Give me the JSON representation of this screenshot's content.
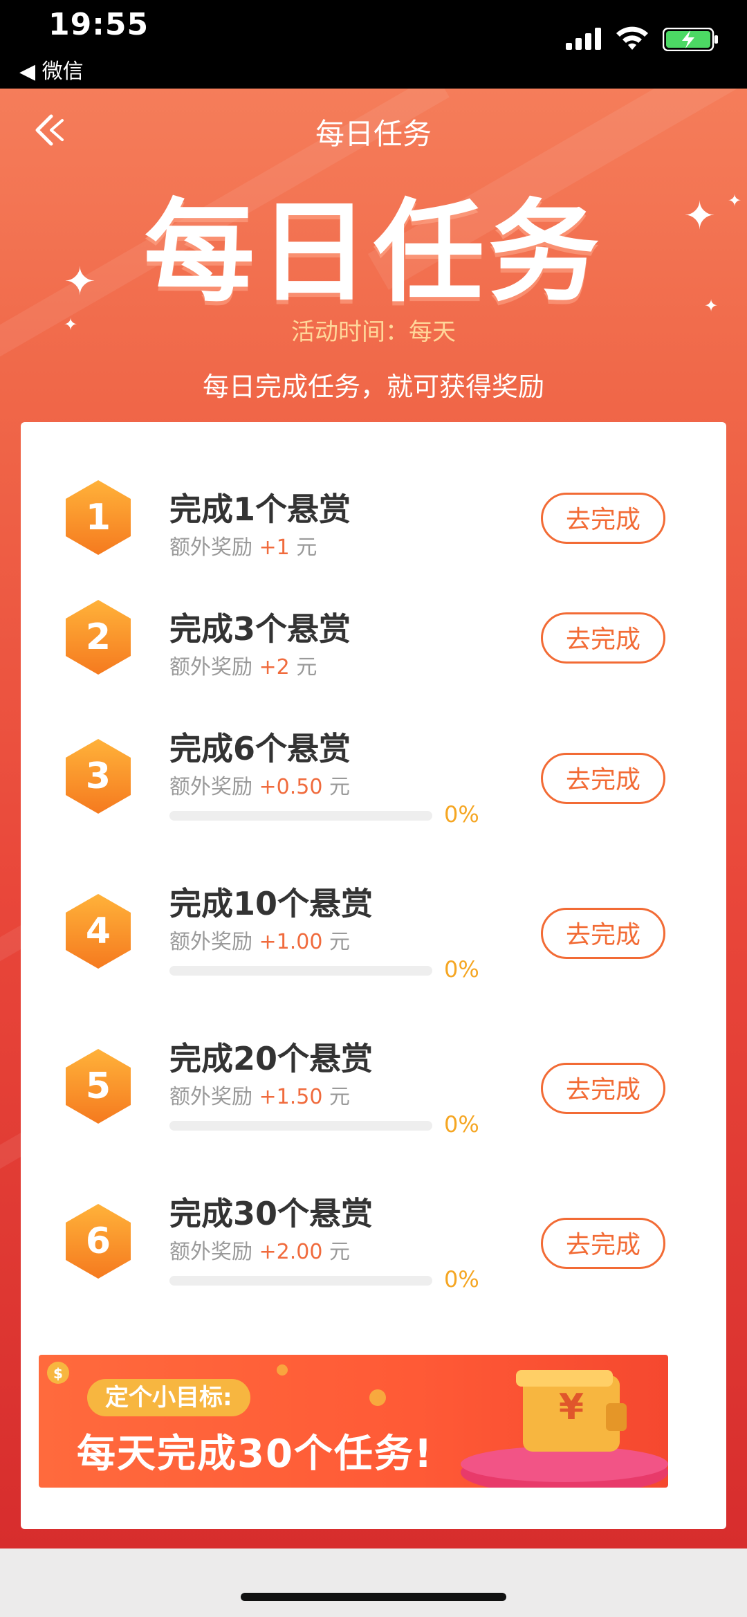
{
  "status_bar": {
    "time": "19:55",
    "back_app": "微信"
  },
  "header": {
    "nav_title": "每日任务",
    "hero_title": "每日任务",
    "activity_time": "活动时间：每天",
    "subtitle": "每日完成任务，就可获得奖励"
  },
  "tasks": [
    {
      "num": "1",
      "title": "完成1个悬赏",
      "reward_prefix": "额外奖励",
      "reward_amount": "+1",
      "reward_unit": "元",
      "button": "去完成"
    },
    {
      "num": "2",
      "title": "完成3个悬赏",
      "reward_prefix": "额外奖励",
      "reward_amount": "+2",
      "reward_unit": "元",
      "button": "去完成"
    },
    {
      "num": "3",
      "title": "完成6个悬赏",
      "reward_prefix": "额外奖励",
      "reward_amount": "+0.50",
      "reward_unit": "元",
      "progress": 0,
      "progress_text": "0%",
      "button": "去完成"
    },
    {
      "num": "4",
      "title": "完成10个悬赏",
      "reward_prefix": "额外奖励",
      "reward_amount": "+1.00",
      "reward_unit": "元",
      "progress": 0,
      "progress_text": "0%",
      "button": "去完成"
    },
    {
      "num": "5",
      "title": "完成20个悬赏",
      "reward_prefix": "额外奖励",
      "reward_amount": "+1.50",
      "reward_unit": "元",
      "progress": 0,
      "progress_text": "0%",
      "button": "去完成"
    },
    {
      "num": "6",
      "title": "完成30个悬赏",
      "reward_prefix": "额外奖励",
      "reward_amount": "+2.00",
      "reward_unit": "元",
      "progress": 0,
      "progress_text": "0%",
      "button": "去完成"
    }
  ],
  "banner": {
    "tag": "定个小目标:",
    "main": "每天完成30个任务!",
    "wallet_symbol": "¥"
  },
  "colors": {
    "accent": "#f26b35",
    "progress": "#f5a623",
    "hex_gradient_top": "#ffb23a",
    "hex_gradient_bottom": "#f57a1f"
  }
}
